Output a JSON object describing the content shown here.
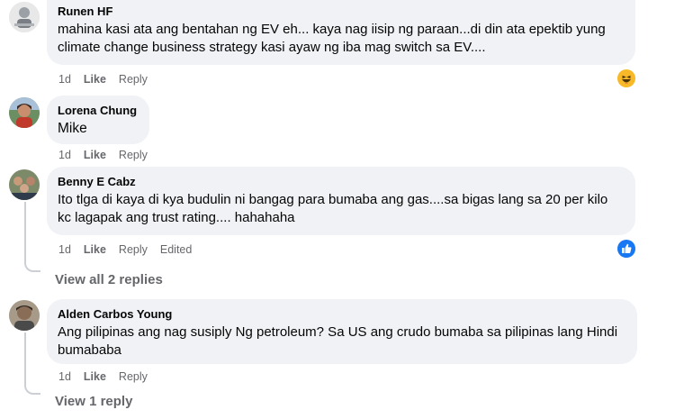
{
  "comments": [
    {
      "author": "Runen HF",
      "text": "mahina kasi ata ang bentahan ng EV eh... kaya nag iisip ng paraan...di din ata epektib yung climate change business strategy kasi ayaw ng iba mag switch sa EV....",
      "time": "1d",
      "like": "Like",
      "reply": "Reply",
      "reaction": "haha-icon"
    },
    {
      "author": "Lorena Chung",
      "text": "Mike",
      "time": "1d",
      "like": "Like",
      "reply": "Reply"
    },
    {
      "author": "Benny E Cabz",
      "text": "Ito tlga di kaya di kya budulin ni bangag para bumaba ang gas....sa bigas lang sa 20 per kilo kc lagapak ang trust rating.... hahahaha",
      "time": "1d",
      "like": "Like",
      "reply": "Reply",
      "edited": "Edited",
      "reaction": "like-icon",
      "view_replies": "View all 2 replies"
    },
    {
      "author": "Alden Carbos Young",
      "text": "Ang pilipinas ang nag susiply Ng petroleum? Sa US ang crudo bumaba sa pilipinas lang Hindi bumababa",
      "time": "1d",
      "like": "Like",
      "reply": "Reply",
      "view_replies": "View 1 reply"
    }
  ],
  "colors": {
    "bubble": "#f0f2f5",
    "meta": "#65676b",
    "like_blue": "#1877f2",
    "haha_yellow": "#f7b928"
  }
}
